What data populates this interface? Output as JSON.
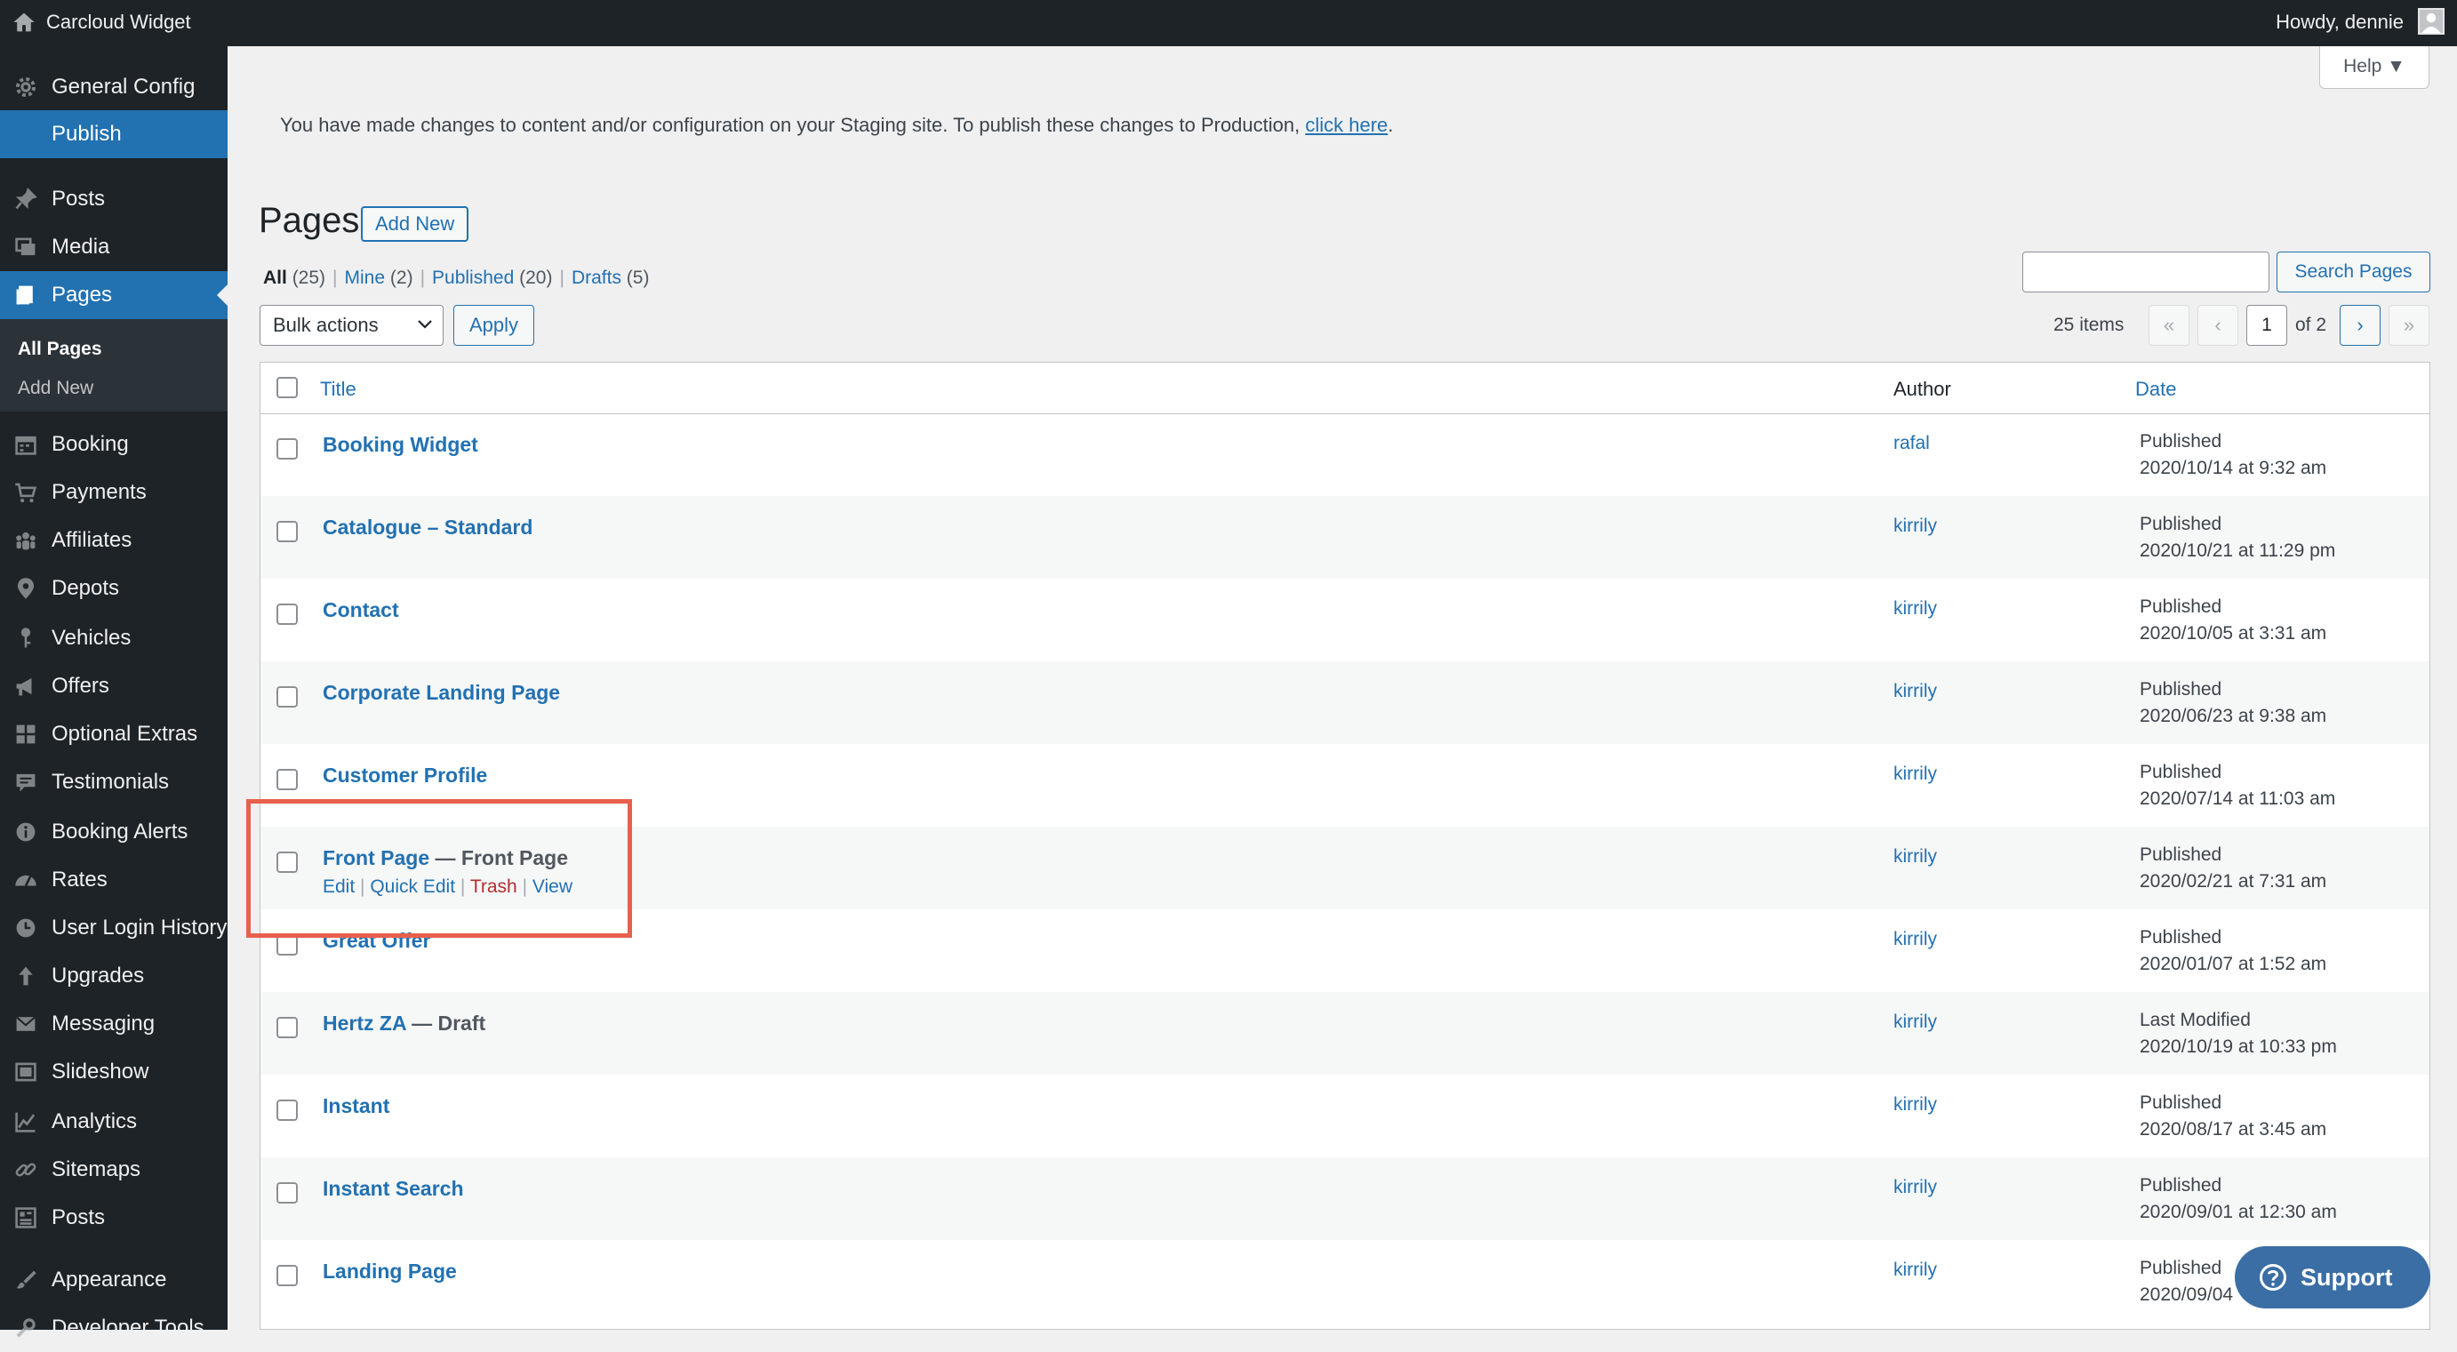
{
  "admin_bar": {
    "site_name": "Carcloud Widget",
    "greeting": "Howdy, dennie"
  },
  "sidebar": {
    "items": [
      {
        "label": "General Config",
        "icon": "gear-icon"
      },
      {
        "label": "Publish",
        "icon": ""
      },
      {
        "label": "Posts",
        "icon": "pin-icon"
      },
      {
        "label": "Media",
        "icon": "media-icon"
      },
      {
        "label": "Pages",
        "icon": "pages-icon"
      },
      {
        "label": "Booking",
        "icon": "calendar-icon"
      },
      {
        "label": "Payments",
        "icon": "cart-icon"
      },
      {
        "label": "Affiliates",
        "icon": "groups-icon"
      },
      {
        "label": "Depots",
        "icon": "location-pin-icon"
      },
      {
        "label": "Vehicles",
        "icon": "key-icon"
      },
      {
        "label": "Offers",
        "icon": "megaphone-icon"
      },
      {
        "label": "Optional Extras",
        "icon": "grid-icon"
      },
      {
        "label": "Testimonials",
        "icon": "comment-icon"
      },
      {
        "label": "Booking Alerts",
        "icon": "info-icon"
      },
      {
        "label": "Rates",
        "icon": "dashboard-icon"
      },
      {
        "label": "User Login History",
        "icon": "clock-icon"
      },
      {
        "label": "Upgrades",
        "icon": "arrow-up-icon"
      },
      {
        "label": "Messaging",
        "icon": "envelope-icon"
      },
      {
        "label": "Slideshow",
        "icon": "slides-icon"
      },
      {
        "label": "Analytics",
        "icon": "chart-line-icon"
      },
      {
        "label": "Sitemaps",
        "icon": "link-icon"
      },
      {
        "label": "Posts",
        "icon": "archive-icon"
      },
      {
        "label": "Appearance",
        "icon": "brush-icon"
      },
      {
        "label": "Developer Tools",
        "icon": "tools-icon"
      }
    ],
    "submenu": [
      "All Pages",
      "Add New"
    ]
  },
  "help_label": "Help ▼",
  "notice": {
    "text": "You have made changes to content and/or configuration on your Staging site. To publish these changes to Production, ",
    "link": "click here",
    "end": "."
  },
  "page": {
    "title": "Pages",
    "add_new": "Add New"
  },
  "views": {
    "all": "All",
    "all_count": "(25)",
    "mine": "Mine",
    "mine_count": "(2)",
    "published": "Published",
    "published_count": "(20)",
    "drafts": "Drafts",
    "drafts_count": "(5)",
    "sep": "|"
  },
  "search": {
    "button": "Search Pages",
    "value": ""
  },
  "bulk": {
    "selected": "Bulk actions",
    "apply": "Apply"
  },
  "pagination": {
    "items": "25 items",
    "first": "«",
    "prev": "‹",
    "current": "1",
    "of": "of 2",
    "next": "›",
    "last": "»"
  },
  "table": {
    "headers": {
      "title": "Title",
      "author": "Author",
      "date": "Date"
    },
    "row_actions": {
      "edit": "Edit",
      "quick_edit": "Quick Edit",
      "trash": "Trash",
      "view": "View",
      "sep": "|"
    },
    "rows": [
      {
        "title": "Booking Widget",
        "state": "",
        "author": "rafal",
        "status": "Published",
        "date": "2020/10/14 at 9:32 am"
      },
      {
        "title": "Catalogue – Standard",
        "state": "",
        "author": "kirrily",
        "status": "Published",
        "date": "2020/10/21 at 11:29 pm"
      },
      {
        "title": "Contact",
        "state": "",
        "author": "kirrily",
        "status": "Published",
        "date": "2020/10/05 at 3:31 am"
      },
      {
        "title": "Corporate Landing Page",
        "state": "",
        "author": "kirrily",
        "status": "Published",
        "date": "2020/06/23 at 9:38 am"
      },
      {
        "title": "Customer Profile",
        "state": "",
        "author": "kirrily",
        "status": "Published",
        "date": "2020/07/14 at 11:03 am"
      },
      {
        "title": "Front Page",
        "state": " — Front Page",
        "author": "kirrily",
        "status": "Published",
        "date": "2020/02/21 at 7:31 am"
      },
      {
        "title": "Great Offer",
        "state": "",
        "author": "kirrily",
        "status": "Published",
        "date": "2020/01/07 at 1:52 am"
      },
      {
        "title": "Hertz ZA",
        "state": " — Draft",
        "author": "kirrily",
        "status": "Last Modified",
        "date": "2020/10/19 at 10:33 pm"
      },
      {
        "title": "Instant",
        "state": "",
        "author": "kirrily",
        "status": "Published",
        "date": "2020/08/17 at 3:45 am"
      },
      {
        "title": "Instant Search",
        "state": "",
        "author": "kirrily",
        "status": "Published",
        "date": "2020/09/01 at 12:30 am"
      },
      {
        "title": "Landing Page",
        "state": "",
        "author": "kirrily",
        "status": "Published",
        "date": "2020/09/04"
      }
    ]
  },
  "support_label": "Support"
}
